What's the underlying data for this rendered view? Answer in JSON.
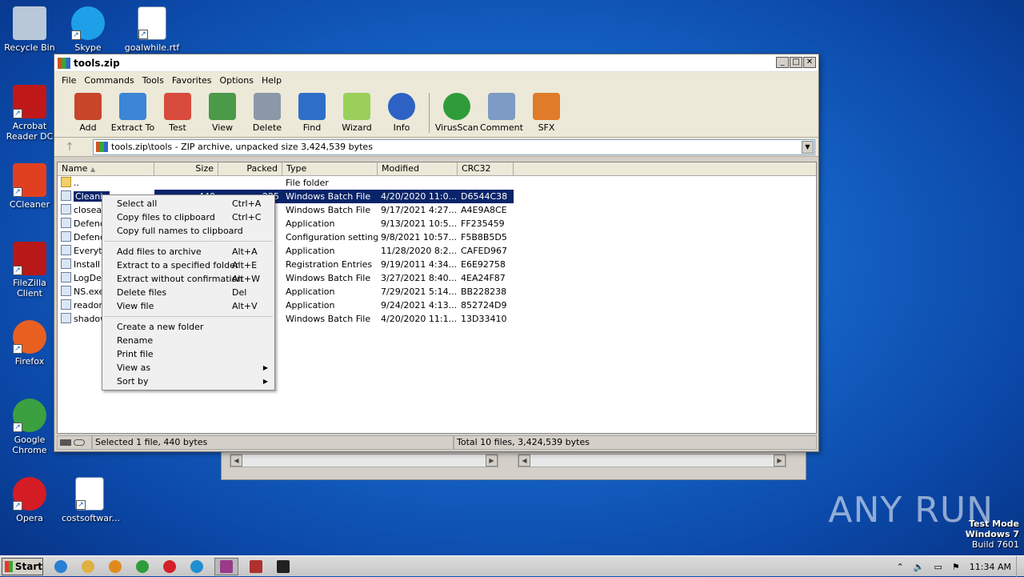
{
  "desktop": {
    "icons": [
      {
        "label": "Recycle Bin",
        "icon": "recycle-bin-icon"
      },
      {
        "label": "Skype",
        "icon": "skype-icon"
      },
      {
        "label": "goalwhile.rtf",
        "icon": "word-document-icon"
      },
      {
        "label": "Acrobat Reader DC",
        "icon": "acrobat-icon"
      },
      {
        "label": "CCleaner",
        "icon": "ccleaner-icon"
      },
      {
        "label": "FileZilla Client",
        "icon": "filezilla-icon"
      },
      {
        "label": "Firefox",
        "icon": "firefox-icon"
      },
      {
        "label": "Google Chrome",
        "icon": "chrome-icon"
      },
      {
        "label": "Opera",
        "icon": "opera-icon"
      },
      {
        "label": "costsoftwar...",
        "icon": "word-document-icon"
      }
    ]
  },
  "window": {
    "title": "tools.zip",
    "menu": [
      "File",
      "Commands",
      "Tools",
      "Favorites",
      "Options",
      "Help"
    ],
    "toolbar": [
      {
        "label": "Add",
        "icon": "add-archive-icon",
        "color": "#c8452a"
      },
      {
        "label": "Extract To",
        "icon": "extract-folder-icon",
        "color": "#3b86d6"
      },
      {
        "label": "Test",
        "icon": "test-clipboard-icon",
        "color": "#d84b3c"
      },
      {
        "label": "View",
        "icon": "view-book-icon",
        "color": "#4a9a4a"
      },
      {
        "label": "Delete",
        "icon": "trash-icon",
        "color": "#8a98a8"
      },
      {
        "label": "Find",
        "icon": "magnifier-icon",
        "color": "#2f6fc9"
      },
      {
        "label": "Wizard",
        "icon": "wand-icon",
        "color": "#9ad05a"
      },
      {
        "label": "Info",
        "icon": "info-icon",
        "color": "#2d62c4"
      },
      {
        "label": "VirusScan",
        "icon": "virus-icon",
        "color": "#2e9c3a"
      },
      {
        "label": "Comment",
        "icon": "comment-icon",
        "color": "#7d9bc4"
      },
      {
        "label": "SFX",
        "icon": "sfx-box-icon",
        "color": "#e07b2a"
      }
    ],
    "address": "tools.zip\\tools - ZIP archive, unpacked size 3,424,539 bytes",
    "columns": [
      "Name",
      "Size",
      "Packed",
      "Type",
      "Modified",
      "CRC32"
    ],
    "rows": [
      {
        "name": "..",
        "size": "",
        "packed": "",
        "type": "File folder",
        "modified": "",
        "crc": "",
        "folder": true
      },
      {
        "name": "Cleanin",
        "size": "440",
        "packed": "225",
        "type": "Windows Batch File",
        "modified": "4/20/2020 11:0...",
        "crc": "D6544C38",
        "selected": true
      },
      {
        "name": "closeap",
        "size": "",
        "packed": "",
        "type": "Windows Batch File",
        "modified": "9/17/2021 4:27...",
        "crc": "A4E9A8CE"
      },
      {
        "name": "Defenc",
        "size": "",
        "packed": "",
        "type": "Application",
        "modified": "9/13/2021 10:5...",
        "crc": "FF235459"
      },
      {
        "name": "Defenc",
        "size": "",
        "packed": "",
        "type": "Configuration settings",
        "modified": "9/8/2021 10:57...",
        "crc": "F5B8B5D5"
      },
      {
        "name": "Everyt",
        "size": "",
        "packed": "",
        "type": "Application",
        "modified": "11/28/2020 8:2...",
        "crc": "CAFED967"
      },
      {
        "name": "Install",
        "size": "",
        "packed": "",
        "type": "Registration Entries",
        "modified": "9/19/2011 4:34...",
        "crc": "E6E92758"
      },
      {
        "name": "LogDel",
        "size": "",
        "packed": "",
        "type": "Windows Batch File",
        "modified": "3/27/2021 8:40...",
        "crc": "4EA24F87"
      },
      {
        "name": "NS.exe",
        "size": "",
        "packed": "",
        "type": "Application",
        "modified": "7/29/2021 5:14...",
        "crc": "BB228238"
      },
      {
        "name": "readon",
        "size": "",
        "packed": "",
        "type": "Application",
        "modified": "9/24/2021 4:13...",
        "crc": "852724D9"
      },
      {
        "name": "shadow",
        "size": "",
        "packed": "",
        "type": "Windows Batch File",
        "modified": "4/20/2020 11:1...",
        "crc": "13D33410"
      }
    ],
    "status_left": "Selected 1 file, 440 bytes",
    "status_right": "Total 10 files, 3,424,539 bytes"
  },
  "context_menu": {
    "groups": [
      [
        {
          "label": "Select all",
          "shortcut": "Ctrl+A"
        },
        {
          "label": "Copy files to clipboard",
          "shortcut": "Ctrl+C"
        },
        {
          "label": "Copy full names to clipboard",
          "shortcut": ""
        }
      ],
      [
        {
          "label": "Add files to archive",
          "shortcut": "Alt+A"
        },
        {
          "label": "Extract to a specified folder",
          "shortcut": "Alt+E"
        },
        {
          "label": "Extract without confirmation",
          "shortcut": "Alt+W"
        },
        {
          "label": "Delete files",
          "shortcut": "Del"
        },
        {
          "label": "View file",
          "shortcut": "Alt+V"
        }
      ],
      [
        {
          "label": "Create a new folder",
          "shortcut": ""
        },
        {
          "label": "Rename",
          "shortcut": ""
        },
        {
          "label": "Print file",
          "shortcut": ""
        },
        {
          "label": "View as",
          "shortcut": "",
          "submenu": true
        },
        {
          "label": "Sort by",
          "shortcut": "",
          "submenu": true
        }
      ]
    ]
  },
  "watermark": "ANY RUN",
  "os_info": {
    "line1": "Test Mode",
    "line2": "Windows 7",
    "line3": "Build 7601"
  },
  "taskbar": {
    "start_label": "Start",
    "apps": [
      {
        "icon": "ie-icon",
        "color": "#2a7fd4"
      },
      {
        "icon": "explorer-icon",
        "color": "#e0b040"
      },
      {
        "icon": "media-player-icon",
        "color": "#e08a1e"
      },
      {
        "icon": "chrome-icon",
        "color": "#2e9c3a"
      },
      {
        "icon": "opera-icon",
        "color": "#d4202a"
      },
      {
        "icon": "edge-icon",
        "color": "#1f8fd0"
      },
      {
        "icon": "winrar-icon",
        "color": "#9a3a8a",
        "active": true
      },
      {
        "icon": "winrar-extract-icon",
        "color": "#b03030"
      },
      {
        "icon": "cmd-icon",
        "color": "#202020"
      }
    ],
    "clock": "11:34 AM"
  }
}
